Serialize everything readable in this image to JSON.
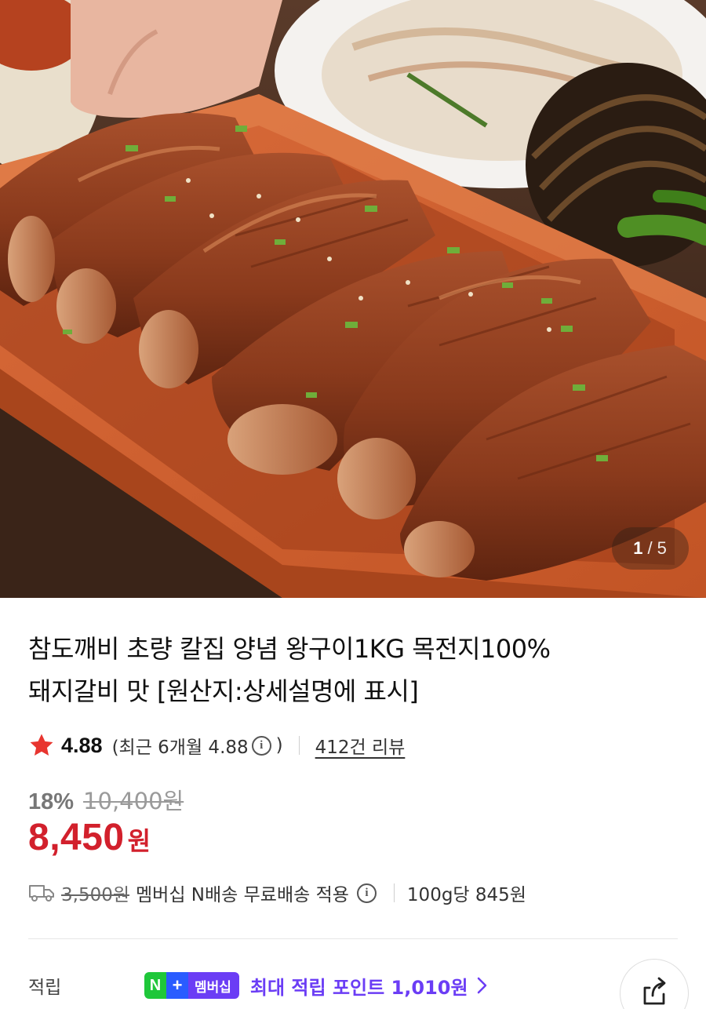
{
  "gallery": {
    "current_page": "1",
    "separator": "/",
    "total_pages": "5",
    "image_subject": "product-photo"
  },
  "product": {
    "title_line1": "참도깨비 초량 칼집 양념 왕구이1KG 목전지100%",
    "title_line2": "돼지갈비 맛 [원산지:상세설명에 표시]"
  },
  "rating": {
    "icon": "star-icon",
    "score": "4.88",
    "recent_prefix": "(최근 6개월 4.88",
    "recent_suffix": ")",
    "review_link": "412건 리뷰"
  },
  "pricing": {
    "discount_rate": "18%",
    "original_price": "10,400원",
    "sale_price": "8,450",
    "currency_unit": "원"
  },
  "shipping": {
    "icon": "truck-icon",
    "fee": "3,500원",
    "benefit_text": "멤버십 N배송 무료배송 적용",
    "unit_price": "100g당 845원"
  },
  "points": {
    "label": "적립",
    "badge_n": "N",
    "badge_plus": "+",
    "badge_text": "멤버십",
    "max_points_text": "최대 적립 포인트 1,010원"
  },
  "colors": {
    "sale_red": "#d2202c",
    "star_red": "#e8352f",
    "membership_purple": "#6b3df5",
    "naver_green": "#1fc73a",
    "plus_blue": "#2a5cff"
  }
}
